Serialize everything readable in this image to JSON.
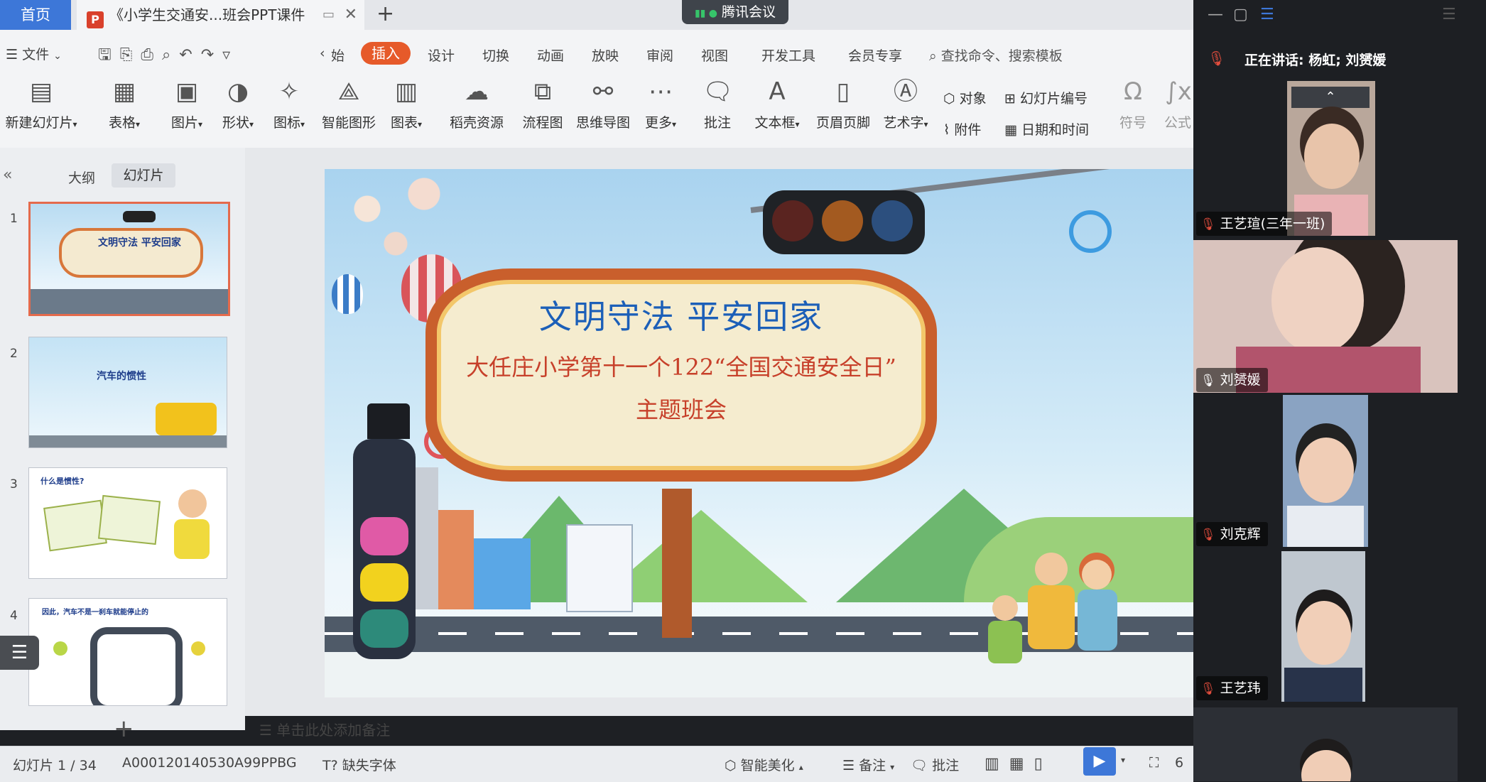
{
  "tabs": {
    "home": "首页",
    "doc": "《小学生交通安...班会PPT课件",
    "add": "+"
  },
  "meeting_badge": "腾讯会议",
  "menu": {
    "file": "文件",
    "start": "始",
    "items": [
      "插入",
      "设计",
      "切换",
      "动画",
      "放映",
      "审阅",
      "视图",
      "开发工具",
      "会员专享"
    ],
    "search": "查找命令、搜索模板"
  },
  "ribbon": {
    "big": [
      "新建幻灯片",
      "表格",
      "图片",
      "形状",
      "图标",
      "智能图形",
      "图表",
      "稻壳资源",
      "流程图",
      "思维导图",
      "更多",
      "批注",
      "文本框",
      "页眉页脚",
      "艺术字"
    ],
    "small": [
      "对象",
      "幻灯片编号",
      "附件",
      "日期和时间"
    ],
    "tail": [
      "符号",
      "公式"
    ]
  },
  "panel": {
    "tab_outline": "大纲",
    "tab_slides": "幻灯片",
    "thumbs": [
      {
        "num": "1",
        "label": "文明守法 平安回家"
      },
      {
        "num": "2",
        "label": "汽车的惯性"
      },
      {
        "num": "3",
        "label": "什么是惯性?"
      },
      {
        "num": "4",
        "label": "因此，汽车不是一刹车就能停止的"
      }
    ],
    "add": "+"
  },
  "slide": {
    "title": "文明守法  平安回家",
    "subtitle": "大任庄小学第十一个122“全国交通安全日”",
    "subtitle2": "主题班会"
  },
  "notes_placeholder": "单击此处添加备注",
  "status": {
    "slide_count": "幻灯片 1 / 34",
    "code": "A000120140530A99PPBG",
    "missing_font": "缺失字体",
    "beautify": "智能美化",
    "notes": "备注",
    "comments": "批注",
    "zoom": "6"
  },
  "meeting": {
    "speaking": "正在讲话: 杨虹; 刘赟媛",
    "participants": [
      {
        "name": "王艺瑄(三年一班)"
      },
      {
        "name": "刘赟媛"
      },
      {
        "name": "刘克辉"
      },
      {
        "name": "王艺玮"
      }
    ]
  },
  "colors": {
    "accent": "#e65a2a",
    "blue": "#3d77d8",
    "slide_title": "#1c5fb8",
    "slide_sub": "#c7402a"
  }
}
